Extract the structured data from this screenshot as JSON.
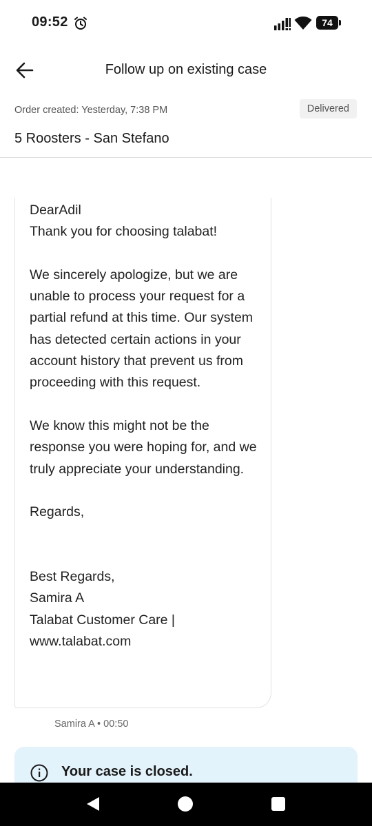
{
  "status_bar": {
    "time": "09:52",
    "battery": "74",
    "icons": [
      "alarm-icon",
      "signal-icon",
      "wifi-icon",
      "battery-icon"
    ]
  },
  "header": {
    "title": "Follow up on existing case",
    "back_icon": "arrow-left-icon"
  },
  "order": {
    "created": "Order created: Yesterday, 7:38 PM",
    "status": "Delivered",
    "restaurant": "5 Roosters - San Stefano"
  },
  "message": {
    "body": "DearAdil\nThank you for choosing talabat!\n\nWe sincerely apologize, but we are unable to process your request for a partial refund at this time. Our system has detected certain actions in your account history that prevent us from proceeding with this request.\n\nWe know this might not be the response you were hoping for, and we truly appreciate your understanding.\n\nRegards,\n\n\nBest Regards,\nSamira A\nTalabat Customer Care |\nwww.talabat.com",
    "meta": "Samira A • 00:50"
  },
  "case_banner": {
    "text": "Your case is closed.",
    "icon": "info-icon",
    "background": "#e3f3fb"
  },
  "nav_bar": {
    "icons": [
      "nav-back-icon",
      "nav-home-icon",
      "nav-recents-icon"
    ]
  }
}
